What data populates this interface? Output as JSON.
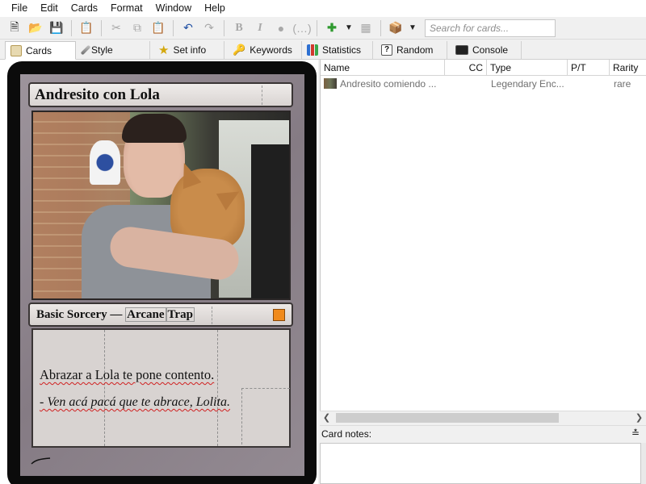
{
  "menu": [
    "File",
    "Edit",
    "Cards",
    "Format",
    "Window",
    "Help"
  ],
  "toolbar": {
    "search_placeholder": "Search for cards...",
    "icons": [
      "new-icon",
      "open-icon",
      "save-icon",
      "export-icon",
      "cut-icon",
      "copy-icon",
      "paste-icon",
      "undo-icon",
      "redo-icon",
      "bold-icon",
      "italic-icon",
      "symbol-icon",
      "reminder-icon",
      "add-card-icon",
      "dropdown-icon",
      "remove-card-icon",
      "style-icon",
      "dropdown-icon"
    ]
  },
  "tabs": [
    {
      "label": "Cards",
      "icon": "cards-icon"
    },
    {
      "label": "Style",
      "icon": "brush-icon"
    },
    {
      "label": "Set info",
      "icon": "star-icon"
    },
    {
      "label": "Keywords",
      "icon": "key-icon"
    },
    {
      "label": "Statistics",
      "icon": "bar-chart-icon"
    },
    {
      "label": "Random",
      "icon": "question-icon"
    },
    {
      "label": "Console",
      "icon": "console-icon"
    }
  ],
  "card": {
    "name": "Andresito con Lola",
    "type_main": "Basic Sorcery",
    "type_dash": "—",
    "type_sub1": "Arcane",
    "type_sub2": "Trap",
    "rules_text": "Abrazar a Lola te pone contento.",
    "flavor_text": "- Ven acá pacá que te abrace, Lolita.",
    "rarity_color": "#f08a1c"
  },
  "list": {
    "columns": [
      "Name",
      "CC",
      "Type",
      "P/T",
      "Rarity"
    ],
    "rows": [
      {
        "name": "Andresito comiendo ...",
        "cc": "",
        "type": "Legendary Enc...",
        "pt": "",
        "rarity": "rare"
      }
    ]
  },
  "notes": {
    "label": "Card notes:",
    "value": ""
  }
}
